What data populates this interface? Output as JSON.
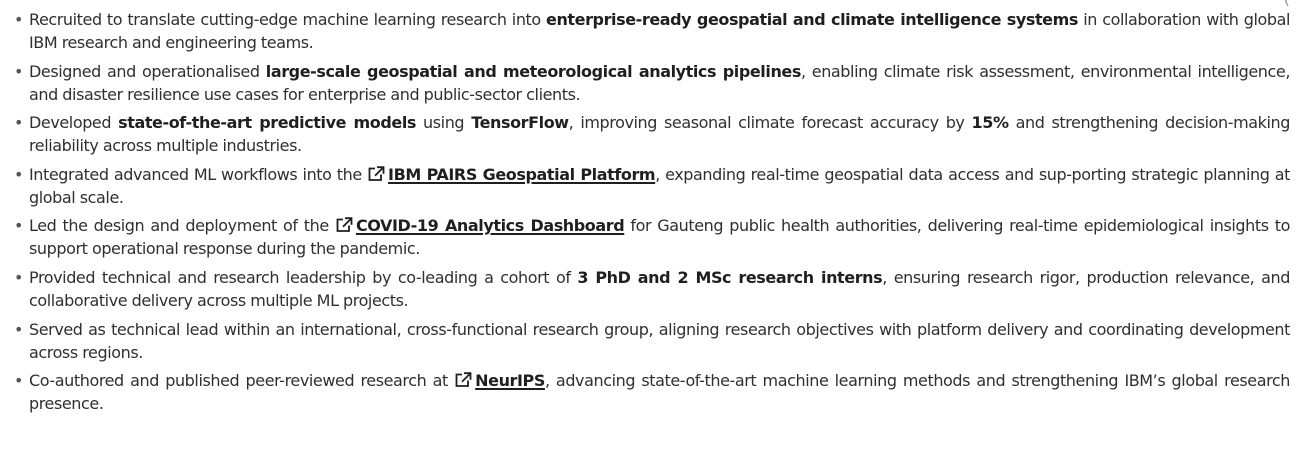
{
  "corner_mark": "(",
  "bullets": [
    {
      "pre": "Recruited to translate cutting-edge machine learning research into ",
      "bold": "enterprise-ready geospatial and climate intelligence systems",
      "post": " in collaboration with global IBM research and engineering teams."
    },
    {
      "pre": "Designed and operationalised ",
      "bold": "large-scale geospatial and meteorological analytics pipelines",
      "post": ", enabling climate risk assessment, environmental intelligence, and disaster resilience use cases for enterprise and public-sector clients."
    },
    {
      "pre": "Developed ",
      "bold1": "state-of-the-art predictive models",
      "mid1": " using ",
      "bold2": "TensorFlow",
      "mid2": ", improving seasonal climate forecast accuracy by ",
      "bold3": "15%",
      "post": " and strengthening decision-making reliability across multiple industries."
    },
    {
      "pre": "Integrated advanced ML workflows into the ",
      "link": "IBM PAIRS Geospatial Platform",
      "post": ", expanding real-time geospatial data access and sup-porting strategic planning at global scale."
    },
    {
      "pre": "Led the design and deployment of the ",
      "link": "COVID-19 Analytics Dashboard",
      "post": " for Gauteng public health authorities, delivering real-time epidemiological insights to support operational response during the pandemic."
    },
    {
      "pre": "Provided technical and research leadership by co-leading a cohort of ",
      "bold": "3 PhD and 2 MSc research interns",
      "post": ", ensuring research rigor, production relevance, and collaborative delivery across multiple ML projects."
    },
    {
      "text": "Served as technical lead within an international, cross-functional research group, aligning research objectives with platform delivery and coordinating development across regions."
    },
    {
      "pre": "Co-authored and published peer-reviewed research at ",
      "link": "NeurIPS",
      "post": ", advancing state-of-the-art machine learning methods and strengthening IBM’s global research presence."
    }
  ]
}
